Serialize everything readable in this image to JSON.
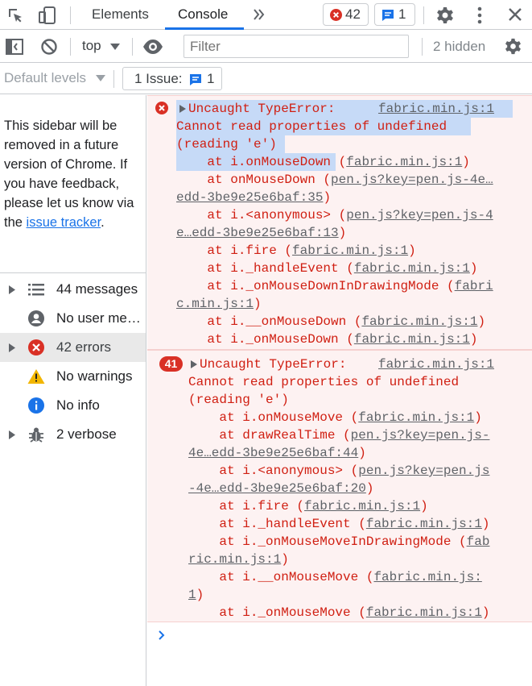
{
  "tabs": {
    "elements": "Elements",
    "console": "Console"
  },
  "badges": {
    "errors": "42",
    "messages": "1"
  },
  "toolbar": {
    "context": "top",
    "filter_placeholder": "Filter",
    "hidden": "2 hidden"
  },
  "toolbar2": {
    "levels": "Default levels",
    "issue_label": "1 Issue:",
    "issue_count": "1"
  },
  "sidebar": {
    "note_pre": "This sidebar will be removed in a future version of Chrome. If you have feedback, please let us know via the",
    "note_link": "issue tracker",
    "note_post": ".",
    "items": [
      {
        "label": "44 messages"
      },
      {
        "label": "No user me…"
      },
      {
        "label": "42 errors"
      },
      {
        "label": "No warnings"
      },
      {
        "label": "No info"
      },
      {
        "label": "2 verbose"
      }
    ]
  },
  "messages": [
    {
      "title": "Uncaught TypeError:",
      "source": "fabric.min.js:1",
      "text1": "Cannot read properties of undefined",
      "text2": "(reading 'e')",
      "stack": [
        {
          "pre": "    at i.onMouseDown (",
          "link": "fabric.min.js:1",
          "post": ")"
        },
        {
          "pre": "    at onMouseDown (",
          "link": "pen.js?key=pen.js-4e…",
          "post": ""
        },
        {
          "pre": "",
          "link": "edd-3be9e25e6baf:35",
          "post": ")"
        },
        {
          "pre": "    at i.<anonymous> (",
          "link": "pen.js?key=pen.js-4",
          "post": ""
        },
        {
          "pre": "",
          "link": "e…edd-3be9e25e6baf:13",
          "post": ")"
        },
        {
          "pre": "    at i.fire (",
          "link": "fabric.min.js:1",
          "post": ")"
        },
        {
          "pre": "    at i._handleEvent (",
          "link": "fabric.min.js:1",
          "post": ")"
        },
        {
          "pre": "    at i._onMouseDownInDrawingMode (",
          "link": "fabri",
          "post": ""
        },
        {
          "pre": "",
          "link": "c.min.js:1",
          "post": ")"
        },
        {
          "pre": "    at i.__onMouseDown (",
          "link": "fabric.min.js:1",
          "post": ")"
        },
        {
          "pre": "    at i._onMouseDown (",
          "link": "fabric.min.js:1",
          "post": ")"
        }
      ]
    },
    {
      "count": "41",
      "title": "Uncaught TypeError:",
      "source": "fabric.min.js:1",
      "text1": "Cannot read properties of undefined",
      "text2": "(reading 'e')",
      "stack": [
        {
          "pre": "    at i.onMouseMove (",
          "link": "fabric.min.js:1",
          "post": ")"
        },
        {
          "pre": "    at drawRealTime (",
          "link": "pen.js?key=pen.js-",
          "post": ""
        },
        {
          "pre": "",
          "link": "4e…edd-3be9e25e6baf:44",
          "post": ")"
        },
        {
          "pre": "    at i.<anonymous> (",
          "link": "pen.js?key=pen.js",
          "post": ""
        },
        {
          "pre": "",
          "link": "-4e…edd-3be9e25e6baf:20",
          "post": ")"
        },
        {
          "pre": "    at i.fire (",
          "link": "fabric.min.js:1",
          "post": ")"
        },
        {
          "pre": "    at i._handleEvent (",
          "link": "fabric.min.js:1",
          "post": ")"
        },
        {
          "pre": "    at i._onMouseMoveInDrawingMode (",
          "link": "fab",
          "post": ""
        },
        {
          "pre": "",
          "link": "ric.min.js:1",
          "post": ")"
        },
        {
          "pre": "    at i.__onMouseMove (",
          "link": "fabric.min.js:",
          "post": ""
        },
        {
          "pre": "",
          "link": "1",
          "post": ")"
        },
        {
          "pre": "    at i._onMouseMove (",
          "link": "fabric.min.js:1",
          "post": ")"
        }
      ]
    }
  ],
  "colors": {
    "error": "#d01f12",
    "accent": "#1a73e8",
    "error_bg": "#fdf2f2"
  }
}
